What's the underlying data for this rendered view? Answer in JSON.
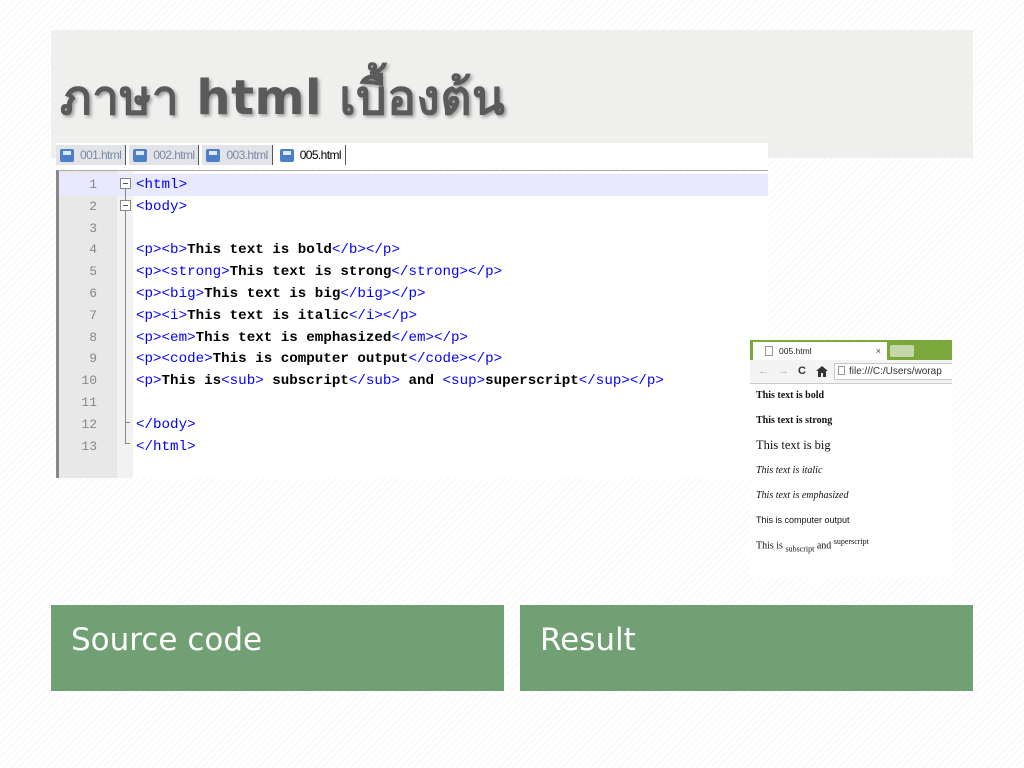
{
  "slide": {
    "title": "ภาษา html เบื้องต้น",
    "caption_left": "Source code",
    "caption_right": "Result"
  },
  "editor": {
    "tabs": [
      {
        "label": "001.html",
        "active": false,
        "icon": "save-file-icon"
      },
      {
        "label": "002.html",
        "active": false,
        "icon": "save-file-icon"
      },
      {
        "label": "003.html",
        "active": false,
        "icon": "save-file-icon"
      },
      {
        "label": "005.html",
        "active": true,
        "icon": "save-file-icon"
      }
    ],
    "lines": [
      {
        "n": "1",
        "parts": [
          {
            "t": "tag",
            "s": "<html>"
          }
        ]
      },
      {
        "n": "2",
        "parts": [
          {
            "t": "tag",
            "s": "<body>"
          }
        ]
      },
      {
        "n": "3",
        "parts": []
      },
      {
        "n": "4",
        "parts": [
          {
            "t": "tag",
            "s": "<p><b>"
          },
          {
            "t": "text",
            "s": "This text is bold"
          },
          {
            "t": "tag",
            "s": "</b></p>"
          }
        ]
      },
      {
        "n": "5",
        "parts": [
          {
            "t": "tag",
            "s": "<p><strong>"
          },
          {
            "t": "text",
            "s": "This text is strong"
          },
          {
            "t": "tag",
            "s": "</strong></p>"
          }
        ]
      },
      {
        "n": "6",
        "parts": [
          {
            "t": "tag",
            "s": "<p><big>"
          },
          {
            "t": "text",
            "s": "This text is big"
          },
          {
            "t": "tag",
            "s": "</big></p>"
          }
        ]
      },
      {
        "n": "7",
        "parts": [
          {
            "t": "tag",
            "s": "<p><i>"
          },
          {
            "t": "text",
            "s": "This text is italic"
          },
          {
            "t": "tag",
            "s": "</i></p>"
          }
        ]
      },
      {
        "n": "8",
        "parts": [
          {
            "t": "tag",
            "s": "<p><em>"
          },
          {
            "t": "text",
            "s": "This text is emphasized"
          },
          {
            "t": "tag",
            "s": "</em></p>"
          }
        ]
      },
      {
        "n": "9",
        "parts": [
          {
            "t": "tag",
            "s": "<p><code>"
          },
          {
            "t": "text",
            "s": "This is computer output"
          },
          {
            "t": "tag",
            "s": "</code></p>"
          }
        ]
      },
      {
        "n": "10",
        "parts": [
          {
            "t": "tag",
            "s": "<p>"
          },
          {
            "t": "text",
            "s": "This is"
          },
          {
            "t": "tag",
            "s": "<sub>"
          },
          {
            "t": "text",
            "s": " subscript"
          },
          {
            "t": "tag",
            "s": "</sub>"
          },
          {
            "t": "text",
            "s": " and "
          },
          {
            "t": "tag",
            "s": "<sup>"
          },
          {
            "t": "text",
            "s": "superscript"
          },
          {
            "t": "tag",
            "s": "</sup></p>"
          }
        ]
      },
      {
        "n": "11",
        "parts": []
      },
      {
        "n": "12",
        "parts": [
          {
            "t": "tag",
            "s": "</body>"
          }
        ]
      },
      {
        "n": "13",
        "parts": [
          {
            "t": "tag",
            "s": "</html>"
          }
        ]
      }
    ],
    "highlighted_line": "1"
  },
  "browser": {
    "tab_title": "005.html",
    "tab_close": "×",
    "url": "file:///C:/Users/worap",
    "nav": {
      "back": "←",
      "forward": "→",
      "reload": "C",
      "home": "home-icon"
    },
    "output": {
      "bold": "This text is bold",
      "strong": "This text is strong",
      "big": "This text is big",
      "italic": "This text is italic",
      "emphasized": "This text is emphasized",
      "code": "This is computer output",
      "sub_prefix": "This is",
      "sub": "subscript",
      "sub_and": "and",
      "sup": "superscript"
    }
  },
  "colors": {
    "caption_bg": "#70a073",
    "title_band": "#efefed",
    "code_tag": "#0000ff",
    "browser_tabbar": "#7aa83a"
  }
}
